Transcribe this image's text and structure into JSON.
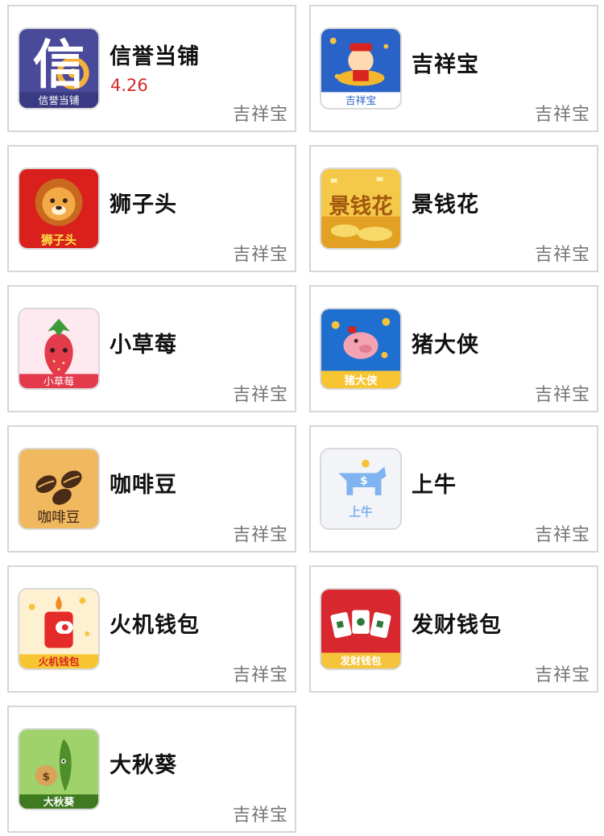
{
  "apps": [
    {
      "name": "信誉当铺",
      "version": "4.26",
      "source": "吉祥宝",
      "icon": "xinyu-dangpu-app-icon",
      "icon_color": "#3f3f8f"
    },
    {
      "name": "吉祥宝",
      "source": "吉祥宝",
      "icon": "jixiangbao-app-icon",
      "icon_color": "#2a63c8"
    },
    {
      "name": "狮子头",
      "source": "吉祥宝",
      "icon": "shizitou-app-icon",
      "icon_color": "#d9201c"
    },
    {
      "name": "景钱花",
      "source": "吉祥宝",
      "icon": "jingqianhua-app-icon",
      "icon_color": "#e6b02b"
    },
    {
      "name": "小草莓",
      "source": "吉祥宝",
      "icon": "xiaocaomei-app-icon",
      "icon_color": "#e33a4c"
    },
    {
      "name": "猪大侠",
      "source": "吉祥宝",
      "icon": "zhudaxia-app-icon",
      "icon_color": "#1f6fd1"
    },
    {
      "name": "咖啡豆",
      "source": "吉祥宝",
      "icon": "kafeidou-app-icon",
      "icon_color": "#f0b960"
    },
    {
      "name": "上牛",
      "source": "吉祥宝",
      "icon": "shangniu-app-icon",
      "icon_color": "#7fb4f0"
    },
    {
      "name": "火机钱包",
      "source": "吉祥宝",
      "icon": "huoji-qianbao-app-icon",
      "icon_color": "#e52a2a"
    },
    {
      "name": "发财钱包",
      "source": "吉祥宝",
      "icon": "facai-qianbao-app-icon",
      "icon_color": "#d8272f"
    },
    {
      "name": "大秋葵",
      "source": "吉祥宝",
      "icon": "daqiukui-app-icon",
      "icon_color": "#7ab840"
    }
  ],
  "icon_labels": {
    "xinyu": "信",
    "xinyu_bottom": "信誉当铺",
    "jixiang_bottom": "吉祥宝",
    "shizi_bottom": "狮子头",
    "jingqian_main": "景钱花",
    "caomei_bottom": "小草莓",
    "zhu_bottom": "猪大侠",
    "kafei_bottom": "咖啡豆",
    "shangniu_bottom": "上牛",
    "huoji_bottom": "火机钱包",
    "facai_bottom": "发财钱包",
    "qiukui_bottom": "大秋葵"
  }
}
